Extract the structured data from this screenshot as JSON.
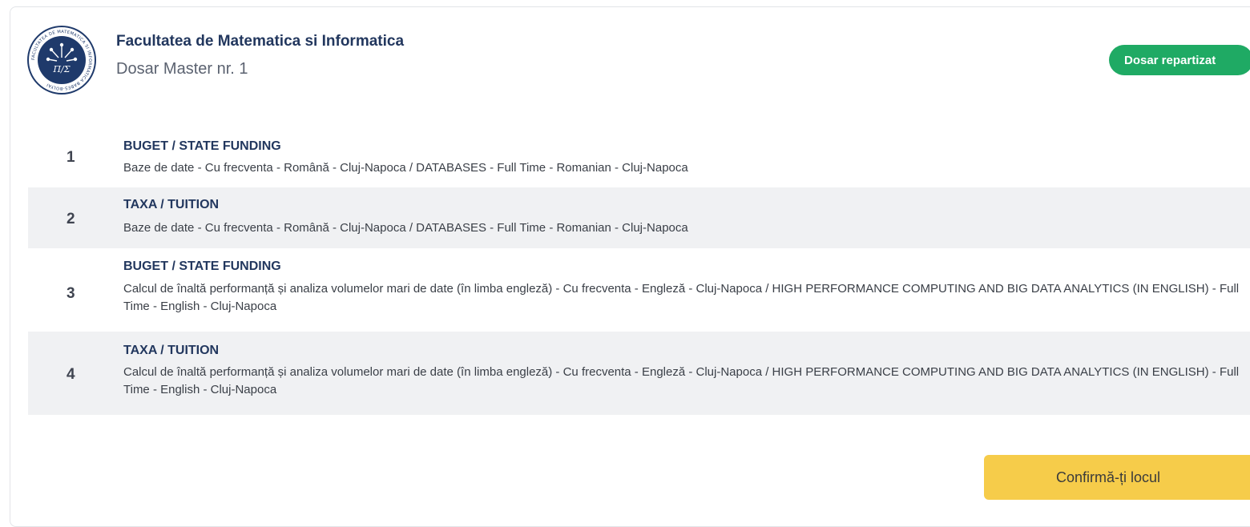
{
  "header": {
    "faculty_name": "Facultatea de Matematica si Informatica",
    "dosar_label": "Dosar Master nr. 1",
    "status_badge": "Dosar repartizat",
    "logo_text": "FACULTATEA DE MATEMATICA SI INFORMATICA BABES-BOLYAI",
    "logo_symbol": "Π/Σ"
  },
  "options": [
    {
      "number": "1",
      "funding": "BUGET / STATE FUNDING",
      "program": "Baze de date - Cu frecventa - Română - Cluj-Napoca / DATABASES - Full Time - Romanian - Cluj-Napoca"
    },
    {
      "number": "2",
      "funding": "TAXA / TUITION",
      "program": "Baze de date - Cu frecventa - Română - Cluj-Napoca / DATABASES - Full Time - Romanian - Cluj-Napoca"
    },
    {
      "number": "3",
      "funding": "BUGET / STATE FUNDING",
      "program": "Calcul de înaltă performanță și analiza volumelor mari de date (în limba engleză) - Cu frecventa - Engleză - Cluj-Napoca / HIGH PERFORMANCE COMPUTING AND BIG DATA ANALYTICS (IN ENGLISH) - Full Time - English - Cluj-Napoca"
    },
    {
      "number": "4",
      "funding": "TAXA / TUITION",
      "program": "Calcul de înaltă performanță și analiza volumelor mari de date (în limba engleză) - Cu frecventa - Engleză - Cluj-Napoca / HIGH PERFORMANCE COMPUTING AND BIG DATA ANALYTICS (IN ENGLISH) - Full Time - English - Cluj-Napoca"
    }
  ],
  "actions": {
    "confirm_label": "Confirmă-ți locul"
  },
  "colors": {
    "badge": "#1faa64",
    "confirm": "#f6cc4a",
    "title": "#22375e",
    "row_alt": "#f0f1f3",
    "logo": "#1f3a6b"
  }
}
